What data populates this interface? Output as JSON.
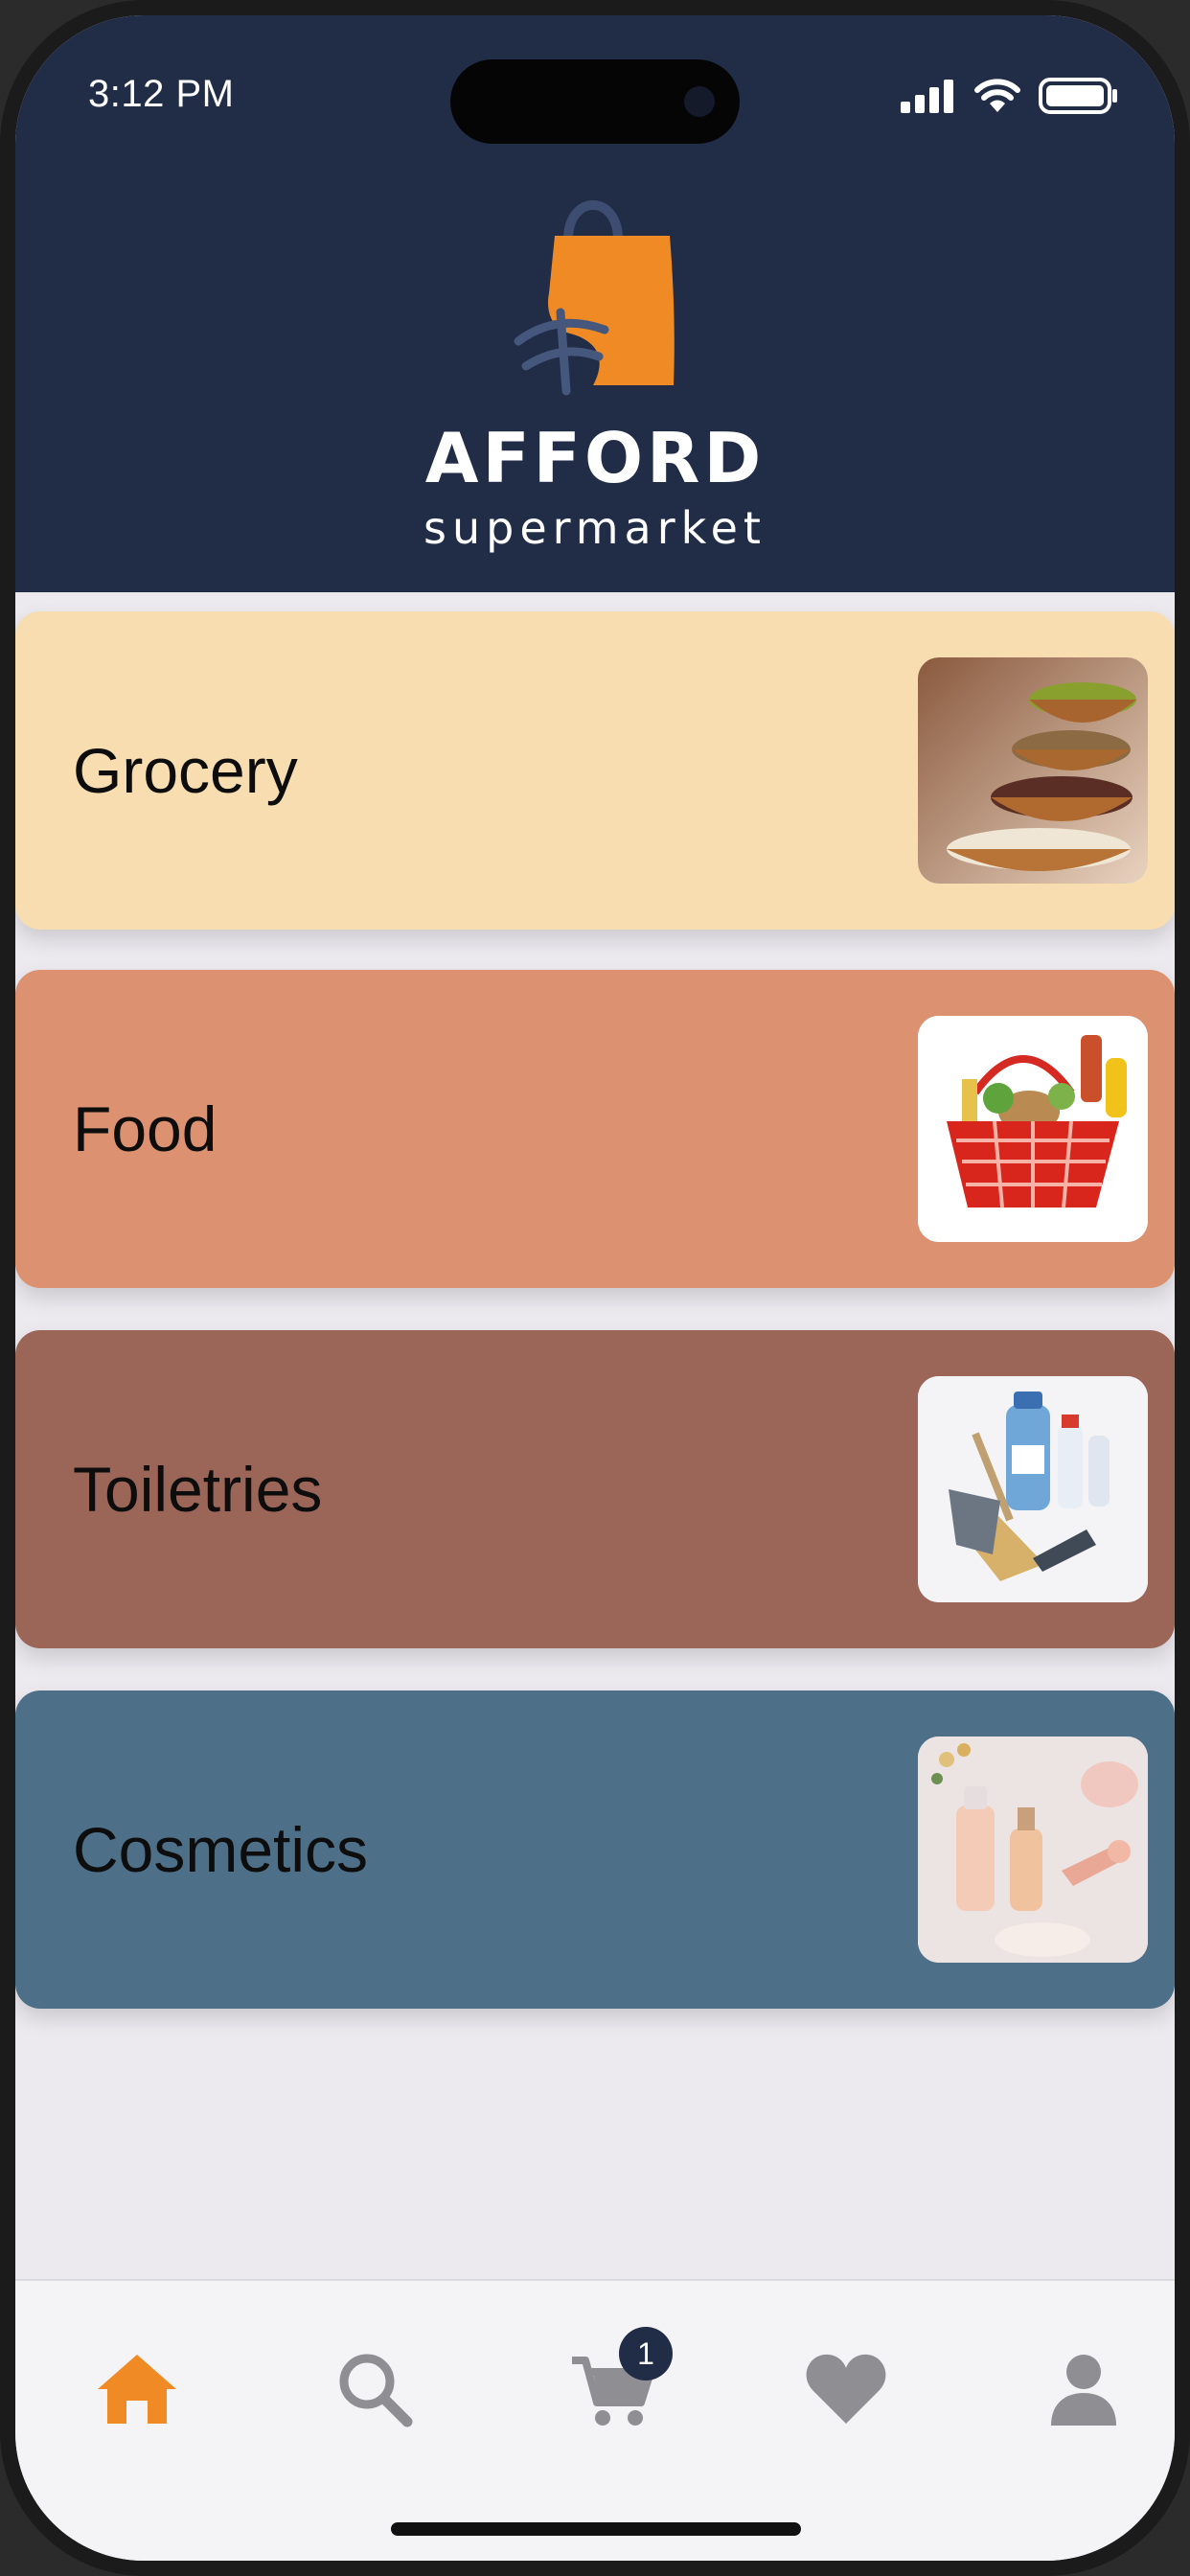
{
  "status_bar": {
    "time": "3:12 PM"
  },
  "brand": {
    "name": "AFFORD",
    "tagline": "supermarket",
    "accent": "#f08a24",
    "header_bg": "#212c47"
  },
  "categories": [
    {
      "label": "Grocery",
      "color": "#f7ddb0",
      "image": "bowls-of-grains-and-legumes"
    },
    {
      "label": "Food",
      "color": "#dc9170",
      "image": "red-shopping-basket-with-groceries"
    },
    {
      "label": "Toiletries",
      "color": "#9b6558",
      "image": "cleaning-supplies-bottles-brush-dustpan"
    },
    {
      "label": "Cosmetics",
      "color": "#4d6f88",
      "image": "skincare-bottles-and-face-roller"
    }
  ],
  "tab_bar": {
    "items": [
      {
        "icon": "home-icon",
        "active": true
      },
      {
        "icon": "search-icon",
        "active": false
      },
      {
        "icon": "cart-icon",
        "active": false
      },
      {
        "icon": "heart-icon",
        "active": false
      },
      {
        "icon": "user-icon",
        "active": false
      }
    ],
    "cart_badge": "1",
    "active_color": "#f08a24",
    "inactive_color": "#8e8e93"
  }
}
